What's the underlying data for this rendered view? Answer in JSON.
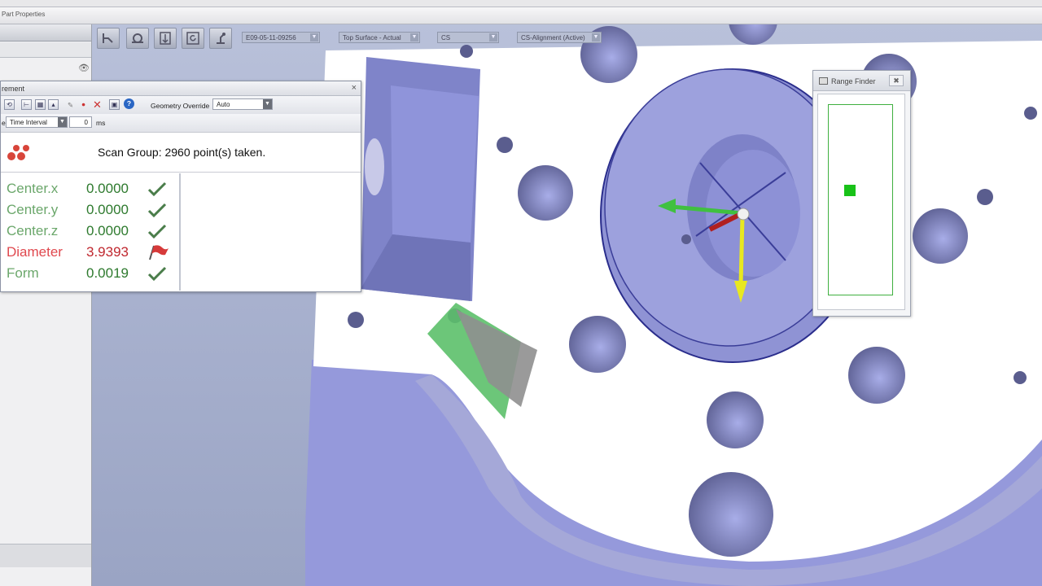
{
  "app": {
    "titlebar_text": "Part Properties"
  },
  "toolbar": {
    "job_combo": "E09-05-11-09256",
    "surface_combo": "Top Surface - Actual",
    "cs_combo": "CS",
    "alignment_combo": "CS-Alignment (Active)"
  },
  "measurement_window": {
    "title": "rement",
    "close_label": "×",
    "geometry_override_label": "Geometry Override",
    "geometry_override_value": "Auto",
    "trigger_label": "e",
    "trigger_mode_value": "Time Interval",
    "interval_value": "0",
    "interval_unit": "ms",
    "scan_message": "Scan Group: 2960 point(s) taken.",
    "results": [
      {
        "name": "Center.x",
        "value": "0.0000",
        "status": "pass"
      },
      {
        "name": "Center.y",
        "value": "0.0000",
        "status": "pass"
      },
      {
        "name": "Center.z",
        "value": "0.0000",
        "status": "pass"
      },
      {
        "name": "Diameter",
        "value": "3.9393",
        "status": "fail"
      },
      {
        "name": "Form",
        "value": "0.0019",
        "status": "pass"
      }
    ]
  },
  "range_finder": {
    "title": "Range Finder",
    "close_label": "✖",
    "level_fraction": 0.45
  },
  "colors": {
    "pass": "#2e7a2e",
    "fail": "#c0282f",
    "part_face": "#ffffff",
    "part_side": "#8f93d4",
    "scan_points": "#5cc06a"
  },
  "icons": [
    "run-icon",
    "probe-icon",
    "align-icon",
    "refresh-icon",
    "robot-icon",
    "dropdown-arrow-icon",
    "checkmark-icon",
    "flag-icon",
    "feature-icon",
    "eye-icon"
  ]
}
